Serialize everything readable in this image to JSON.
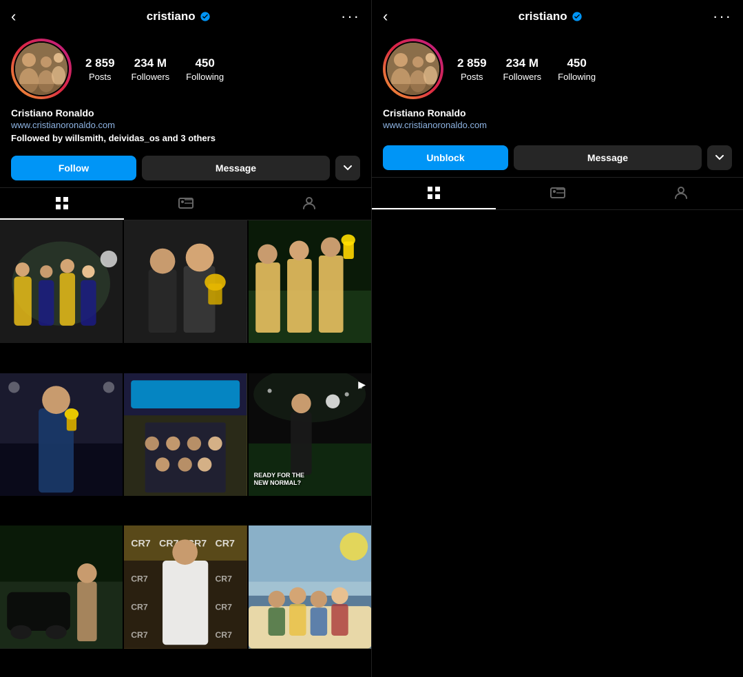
{
  "left": {
    "header": {
      "back_icon": "‹",
      "username": "cristiano",
      "more_icon": "···"
    },
    "profile": {
      "stats": [
        {
          "number": "2 859",
          "label": "Posts"
        },
        {
          "number": "234 M",
          "label": "Followers"
        },
        {
          "number": "450",
          "label": "Following"
        }
      ],
      "name": "Cristiano Ronaldo",
      "link": "www.cristianoronaldo.com",
      "followed_by_prefix": "Followed by ",
      "followed_by_names": "willsmith, deividas_os",
      "followed_by_suffix": " and ",
      "followed_by_others": "3 others"
    },
    "buttons": {
      "follow": "Follow",
      "message": "Message",
      "dropdown": "∨"
    },
    "tabs": [
      {
        "icon": "⊞",
        "active": true
      },
      {
        "icon": "📺",
        "active": false
      },
      {
        "icon": "👤",
        "active": false
      }
    ]
  },
  "right": {
    "header": {
      "back_icon": "‹",
      "username": "cristiano",
      "more_icon": "···"
    },
    "profile": {
      "stats": [
        {
          "number": "2 859",
          "label": "Posts"
        },
        {
          "number": "234 M",
          "label": "Followers"
        },
        {
          "number": "450",
          "label": "Following"
        }
      ],
      "name": "Cristiano Ronaldo",
      "link": "www.cristianoronaldo.com"
    },
    "buttons": {
      "unblock": "Unblock",
      "message": "Message",
      "dropdown": "∨"
    },
    "tabs": [
      {
        "icon": "⊞",
        "active": true
      },
      {
        "icon": "📺",
        "active": false
      },
      {
        "icon": "👤",
        "active": false
      }
    ]
  },
  "grid_overlay": {
    "video_label": "CR",
    "ready_text": "READY FOR THE\nNEW NORMAL?"
  }
}
